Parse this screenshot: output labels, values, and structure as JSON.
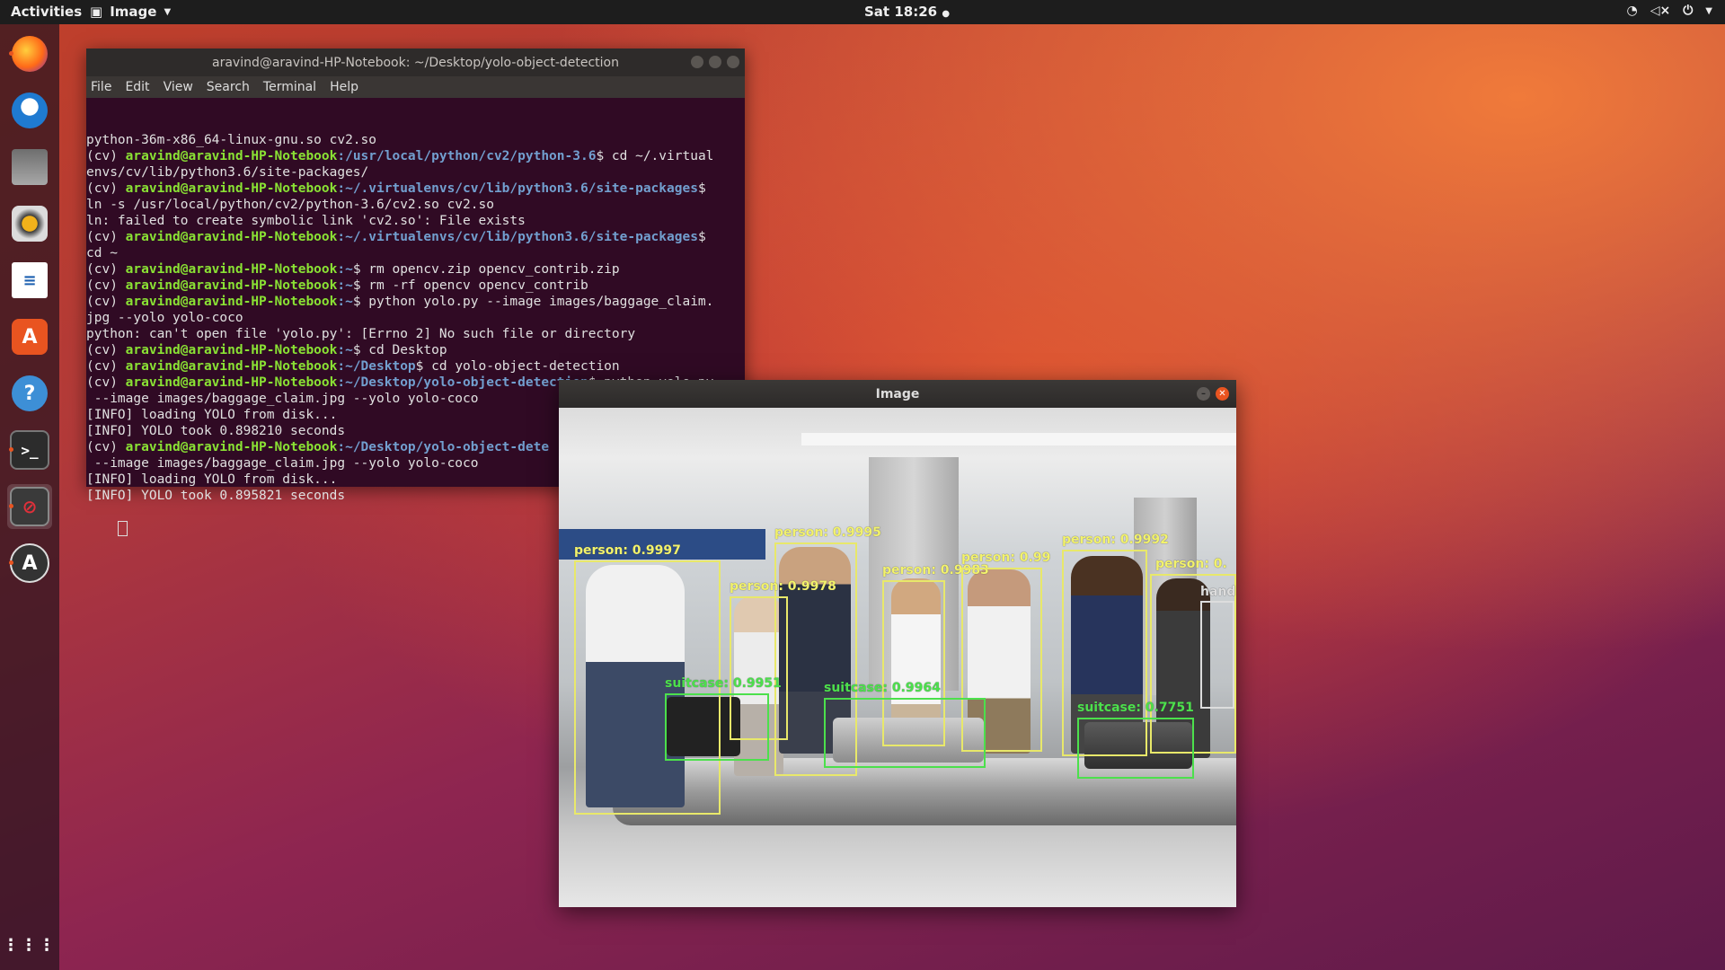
{
  "topbar": {
    "activities": "Activities",
    "app_menu": "Image",
    "clock": "Sat 18:26"
  },
  "terminal": {
    "title": "aravind@aravind-HP-Notebook: ~/Desktop/yolo-object-detection",
    "menu": [
      "File",
      "Edit",
      "View",
      "Search",
      "Terminal",
      "Help"
    ],
    "lines": [
      {
        "pre": "python-36m-x86_64-linux-gnu.so cv2.so",
        "user": "",
        "path": "",
        "post": ""
      },
      {
        "pre": "(cv) ",
        "user": "aravind@aravind-HP-Notebook",
        "path": ":/usr/local/python/cv2/python-3.6",
        "post": "$ cd ~/.virtual"
      },
      {
        "pre": "envs/cv/lib/python3.6/site-packages/",
        "user": "",
        "path": "",
        "post": ""
      },
      {
        "pre": "(cv) ",
        "user": "aravind@aravind-HP-Notebook",
        "path": ":~/.virtualenvs/cv/lib/python3.6/site-packages",
        "post": "$"
      },
      {
        "pre": "ln -s /usr/local/python/cv2/python-3.6/cv2.so cv2.so",
        "user": "",
        "path": "",
        "post": ""
      },
      {
        "pre": "ln: failed to create symbolic link 'cv2.so': File exists",
        "user": "",
        "path": "",
        "post": ""
      },
      {
        "pre": "(cv) ",
        "user": "aravind@aravind-HP-Notebook",
        "path": ":~/.virtualenvs/cv/lib/python3.6/site-packages",
        "post": "$"
      },
      {
        "pre": "cd ~",
        "user": "",
        "path": "",
        "post": ""
      },
      {
        "pre": "(cv) ",
        "user": "aravind@aravind-HP-Notebook",
        "path": ":~",
        "post": "$ rm opencv.zip opencv_contrib.zip"
      },
      {
        "pre": "(cv) ",
        "user": "aravind@aravind-HP-Notebook",
        "path": ":~",
        "post": "$ rm -rf opencv opencv_contrib"
      },
      {
        "pre": "(cv) ",
        "user": "aravind@aravind-HP-Notebook",
        "path": ":~",
        "post": "$ python yolo.py --image images/baggage_claim."
      },
      {
        "pre": "jpg --yolo yolo-coco",
        "user": "",
        "path": "",
        "post": ""
      },
      {
        "pre": "python: can't open file 'yolo.py': [Errno 2] No such file or directory",
        "user": "",
        "path": "",
        "post": ""
      },
      {
        "pre": "(cv) ",
        "user": "aravind@aravind-HP-Notebook",
        "path": ":~",
        "post": "$ cd Desktop"
      },
      {
        "pre": "(cv) ",
        "user": "aravind@aravind-HP-Notebook",
        "path": ":~/Desktop",
        "post": "$ cd yolo-object-detection"
      },
      {
        "pre": "(cv) ",
        "user": "aravind@aravind-HP-Notebook",
        "path": ":~/Desktop/yolo-object-detection",
        "post": "$ python yolo.py"
      },
      {
        "pre": " --image images/baggage_claim.jpg --yolo yolo-coco",
        "user": "",
        "path": "",
        "post": ""
      },
      {
        "pre": "[INFO] loading YOLO from disk...",
        "user": "",
        "path": "",
        "post": ""
      },
      {
        "pre": "[INFO] YOLO took 0.898210 seconds",
        "user": "",
        "path": "",
        "post": ""
      },
      {
        "pre": "(cv) ",
        "user": "aravind@aravind-HP-Notebook",
        "path": ":~/Desktop/yolo-object-dete",
        "post": ""
      },
      {
        "pre": " --image images/baggage_claim.jpg --yolo yolo-coco",
        "user": "",
        "path": "",
        "post": ""
      },
      {
        "pre": "[INFO] loading YOLO from disk...",
        "user": "",
        "path": "",
        "post": ""
      },
      {
        "pre": "[INFO] YOLO took 0.895821 seconds",
        "user": "",
        "path": "",
        "post": ""
      }
    ]
  },
  "image_window": {
    "title": "Image",
    "detections": [
      {
        "label": "person: 0.9997"
      },
      {
        "label": "person: 0.9995"
      },
      {
        "label": "person: 0.9978"
      },
      {
        "label": "person: 0.9983"
      },
      {
        "label": "person: 0.99"
      },
      {
        "label": "person: 0.9992"
      },
      {
        "label": "person: 0."
      },
      {
        "label": "suitcase: 0.9951"
      },
      {
        "label": "suitcase: 0.9964"
      },
      {
        "label": "suitcase: 0.7751"
      },
      {
        "label": "handb"
      }
    ]
  },
  "dock": {
    "items": [
      "firefox-icon",
      "thunderbird-icon",
      "files-icon",
      "rhythmbox-icon",
      "writer-icon",
      "software-icon",
      "help-icon",
      "terminal-icon",
      "image-viewer-icon",
      "software-updater-icon"
    ],
    "show_apps": "show-applications-icon"
  },
  "colors": {
    "terminal_bg": "#300a24",
    "prompt_user": "#8ae234",
    "prompt_path": "#729fcf",
    "box_person": "#e8e86a",
    "box_suitcase": "#4ce04c",
    "accent": "#e95420"
  }
}
